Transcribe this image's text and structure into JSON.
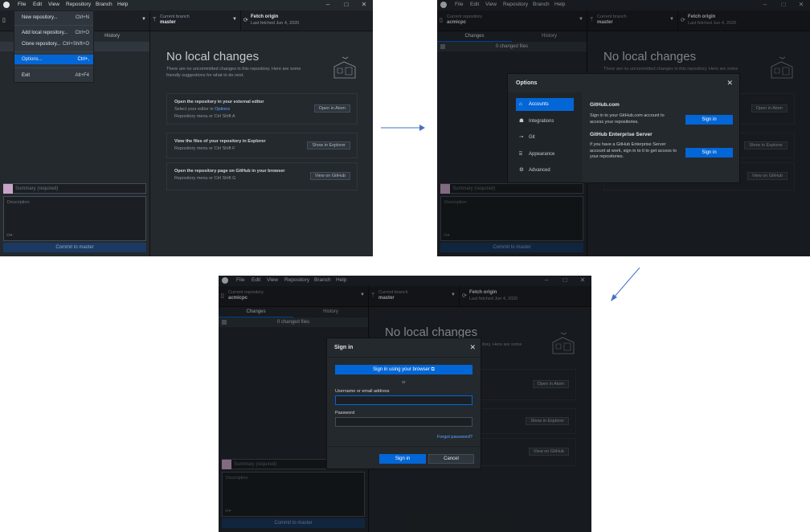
{
  "menu": [
    "File",
    "Edit",
    "View",
    "Repository",
    "Branch",
    "Help"
  ],
  "toolbar": {
    "repo_label": "Current repository",
    "repo_value": "acmicpc",
    "branch_label": "Current branch",
    "branch_value": "master",
    "fetch_label": "Fetch origin",
    "fetch_sub": "Last fetched Jun 4, 2020"
  },
  "tabs": {
    "changes": "Changes",
    "history": "History"
  },
  "changed_files": "0 changed files",
  "summary_placeholder": "Summary (required)",
  "description_placeholder": "Description",
  "commit_button": "Commit to master",
  "no_changes": {
    "title": "No local changes",
    "subtitle": "There are no uncommitted changes in this repository. Here are some friendly suggestions for what to do next.",
    "subtitle_short": "itory. Here are some",
    "cards": [
      {
        "title": "Open the repository in your external editor",
        "sub": "Select your editor in",
        "sub_link": "Options",
        "sub2": "Repository menu or  Ctrl  Shift  A",
        "button": "Open in Atom"
      },
      {
        "title": "View the files of your repository in Explorer",
        "sub": "Repository menu or  Ctrl  Shift  F",
        "button": "Show in Explorer"
      },
      {
        "title": "Open the repository page on GitHub in your browser",
        "sub": "Repository menu or  Ctrl  Shift  G",
        "button": "View on GitHub"
      }
    ]
  },
  "file_menu": [
    {
      "label": "New repository...",
      "key": "Ctrl+N"
    },
    {
      "label": "Add local repository...",
      "key": "Ctrl+O"
    },
    {
      "label": "Clone repository...",
      "key": "Ctrl+Shift+O"
    },
    {
      "label": "Options...",
      "key": "Ctrl+,"
    },
    {
      "label": "Exit",
      "key": "Alt+F4"
    }
  ],
  "options_dialog": {
    "title": "Options",
    "nav": [
      "Accounts",
      "Integrations",
      "Git",
      "Appearance",
      "Advanced"
    ],
    "github_heading": "GitHub.com",
    "github_text": "Sign in to your GitHub.com account to access your repositories.",
    "ghe_heading": "GitHub Enterprise Server",
    "ghe_text": "If you have a GitHub Enterprise Server account at work, sign in to it to get access to your repositories.",
    "sign_in": "Sign in"
  },
  "signin_dialog": {
    "title": "Sign in",
    "browser_button": "Sign in using your browser",
    "or": "or",
    "username_label": "Username or email address",
    "password_label": "Password",
    "forgot": "Forgot password?",
    "sign_in": "Sign in",
    "cancel": "Cancel"
  },
  "colors": {
    "accent": "#0366d6",
    "bg": "#24292e",
    "arrow": "#4472c4"
  }
}
